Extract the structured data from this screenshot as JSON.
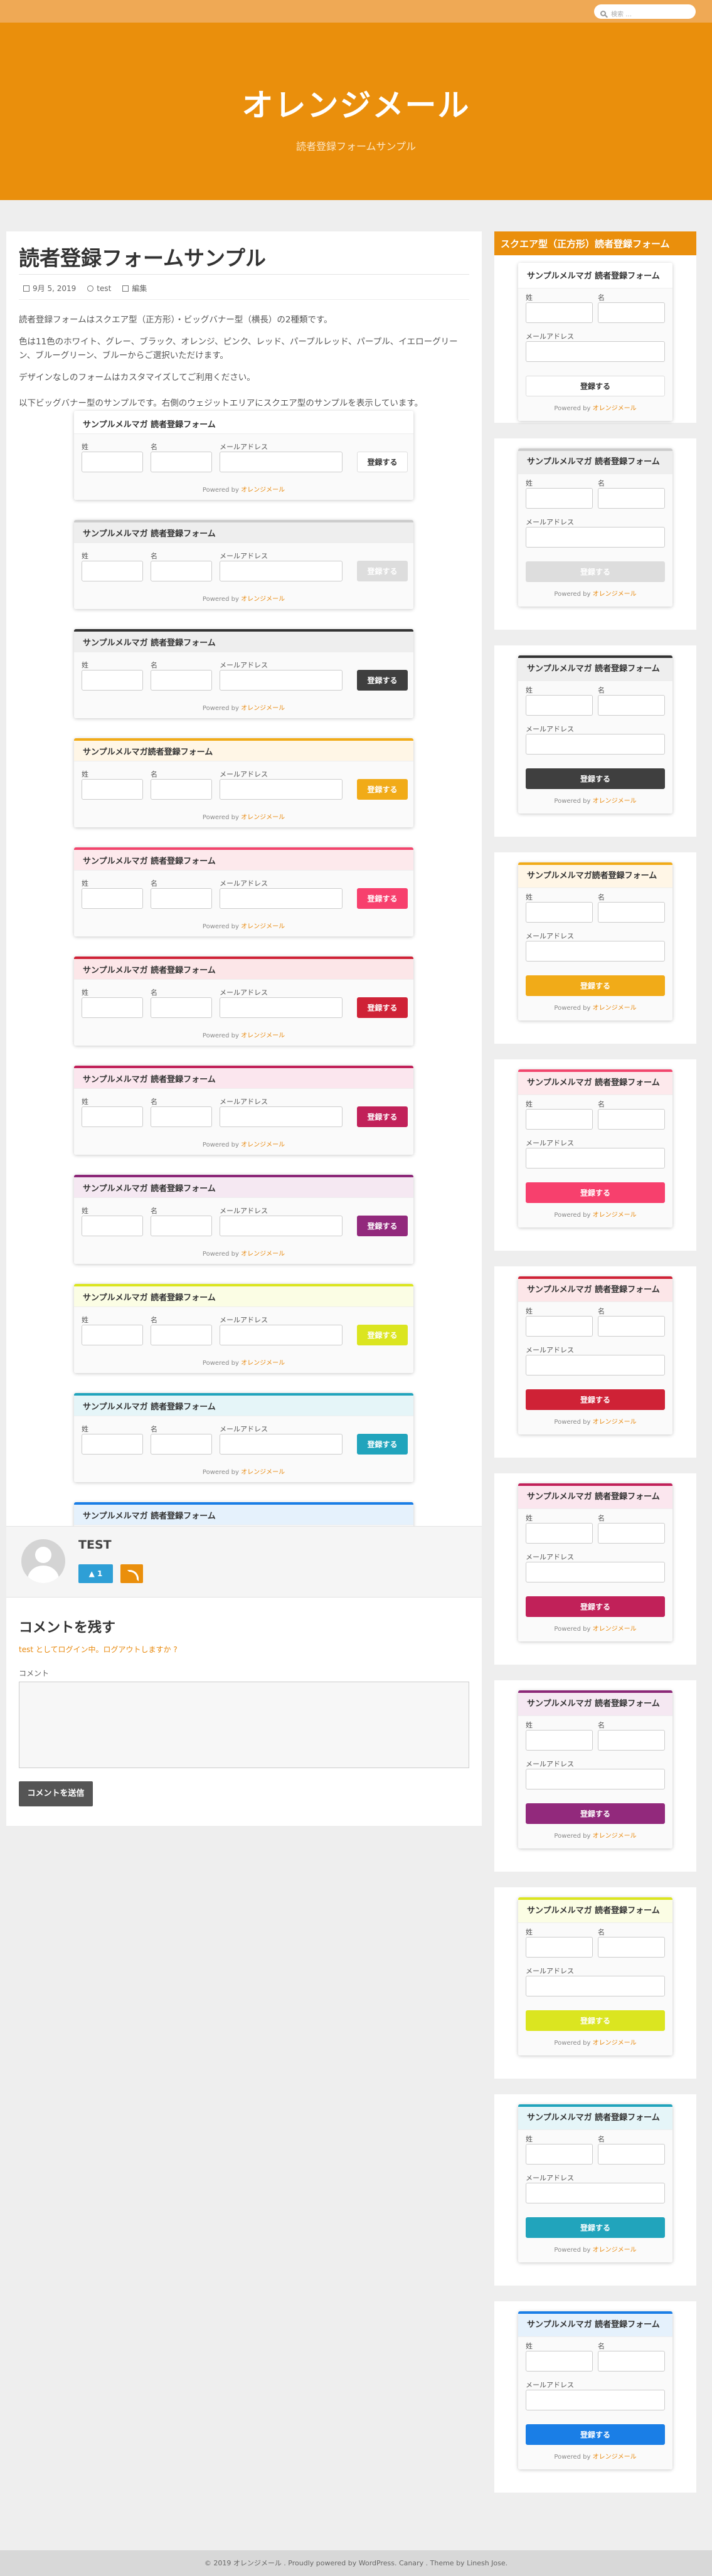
{
  "search": {
    "placeholder": "検索 …"
  },
  "site": {
    "title": "オレンジメール",
    "description": "読者登録フォームサンプル"
  },
  "post": {
    "title": "読者登録フォームサンプル",
    "date": "9月 5, 2019",
    "author": "test",
    "edit": "編集",
    "paragraphs": [
      "読者登録フォームはスクエア型（正方形）・ビッグバナー型（横長）の2種類です。",
      "色は11色のホワイト、グレー、ブラック、オレンジ、ピンク、レッド、パープルレッド、パープル、イエローグリーン、ブルーグリーン、ブルーからご選択いただけます。",
      "デザインなしのフォームはカスタマイズしてご利用ください。",
      "以下ビッグバナー型のサンプルです。右側のウェジットエリアにスクエア型のサンプルを表示しています。"
    ]
  },
  "form": {
    "title": "サンプルメルマガ 読者登録フォーム",
    "title_orange": "サンプルメルマガ読者登録フォーム",
    "sei": "姓",
    "mei": "名",
    "email": "メールアドレス",
    "submit": "登録する",
    "powered": "Powered by",
    "powered_brand": "オレンジメール"
  },
  "themes": [
    {
      "name": "white",
      "border": "#ffffff",
      "head": "#ffffff",
      "btn": "#ffffff",
      "btn_text": "#333333",
      "btn_border": "#dddddd"
    },
    {
      "name": "gray",
      "border": "#cccccc",
      "head": "#eeeeee",
      "btn": "#dddddd",
      "btn_text": "#ffffff",
      "btn_border": "#dddddd"
    },
    {
      "name": "black",
      "border": "#333333",
      "head": "#eeeeee",
      "btn": "#3f3f3f",
      "btn_text": "#ffffff",
      "btn_border": "#3f3f3f"
    },
    {
      "name": "orange",
      "border": "#f1ab18",
      "head": "#fff6e6",
      "btn": "#f1ab18",
      "btn_text": "#ffffff",
      "btn_border": "#f1ab18"
    },
    {
      "name": "pink",
      "border": "#f2466d",
      "head": "#fde9ec",
      "btn": "#f7406d",
      "btn_text": "#ffffff",
      "btn_border": "#f7406d"
    },
    {
      "name": "red",
      "border": "#cf2236",
      "head": "#fce6e8",
      "btn": "#cf2236",
      "btn_text": "#ffffff",
      "btn_border": "#cf2236"
    },
    {
      "name": "purple-red",
      "border": "#c12159",
      "head": "#fbe6ee",
      "btn": "#c12159",
      "btn_text": "#ffffff",
      "btn_border": "#c12159"
    },
    {
      "name": "purple",
      "border": "#8c2878",
      "head": "#f5e8f2",
      "btn": "#92297c",
      "btn_text": "#ffffff",
      "btn_border": "#92297c"
    },
    {
      "name": "yellow-green",
      "border": "#dbe520",
      "head": "#fbfde4",
      "btn": "#dbe520",
      "btn_text": "#ffffff",
      "btn_border": "#dbe520"
    },
    {
      "name": "blue-green",
      "border": "#21a4bc",
      "head": "#e5f5f8",
      "btn": "#21a4bc",
      "btn_text": "#ffffff",
      "btn_border": "#21a4bc"
    },
    {
      "name": "blue",
      "border": "#1a7ee6",
      "head": "#e5f1fc",
      "btn": "#1a7ee6",
      "btn_text": "#ffffff",
      "btn_border": "#1a7ee6"
    }
  ],
  "author_box": {
    "name": "TEST",
    "count": "1"
  },
  "comments": {
    "title": "コメントを残す",
    "logged_in_as": "test としてログイン中。ログアウトしますか ?",
    "label": "コメント",
    "submit": "コメントを送信"
  },
  "sidebar": {
    "widget_title": "スクエア型（正方形）読者登録フォーム"
  },
  "footer": {
    "text": "© 2019  オレンジメール . Proudly powered by WordPress. Canary .  Theme by Linesh Jose."
  },
  "colors": {
    "accent": "#ea8f0c",
    "topbar": "#efa955",
    "background": "#eeeeee"
  }
}
